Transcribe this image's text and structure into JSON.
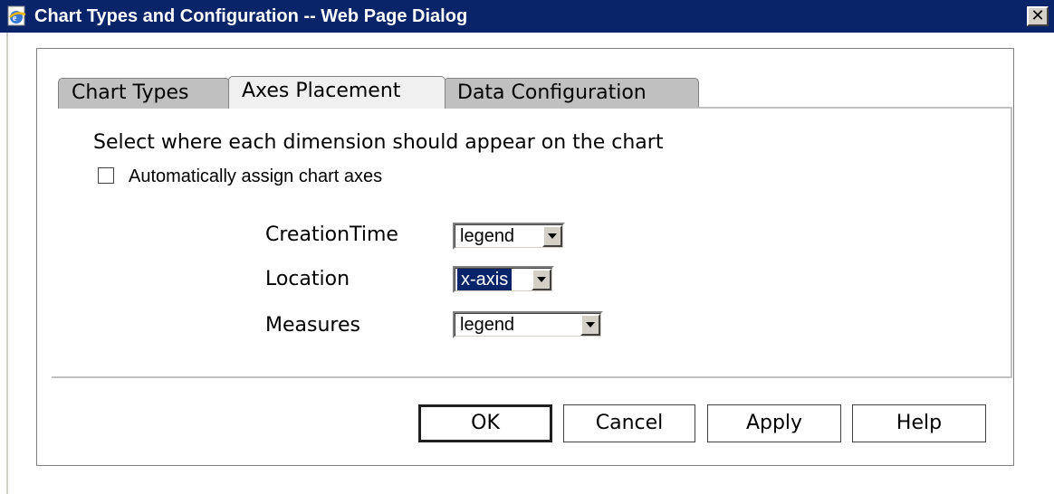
{
  "window": {
    "title": "Chart Types and Configuration -- Web Page Dialog",
    "close_glyph": "✕",
    "icon": "ie-page-icon"
  },
  "tabs": [
    {
      "label": "Chart Types",
      "active": false
    },
    {
      "label": "Axes Placement",
      "active": true
    },
    {
      "label": "Data Configuration",
      "active": false
    }
  ],
  "panel": {
    "instruction": "Select where each dimension should appear on the chart",
    "auto_assign": {
      "label": "Automatically assign chart axes",
      "checked": false
    },
    "dimensions": [
      {
        "label": "CreationTime",
        "value": "legend"
      },
      {
        "label": "Location",
        "value": "x-axis"
      },
      {
        "label": "Measures",
        "value": "legend"
      }
    ]
  },
  "buttons": {
    "ok": "OK",
    "cancel": "Cancel",
    "apply": "Apply",
    "help": "Help"
  },
  "colors": {
    "titlebar": "#0a246a",
    "selection": "#0a246a",
    "tab_inactive": "#c0c0c0",
    "tab_active": "#f0f0f0"
  }
}
